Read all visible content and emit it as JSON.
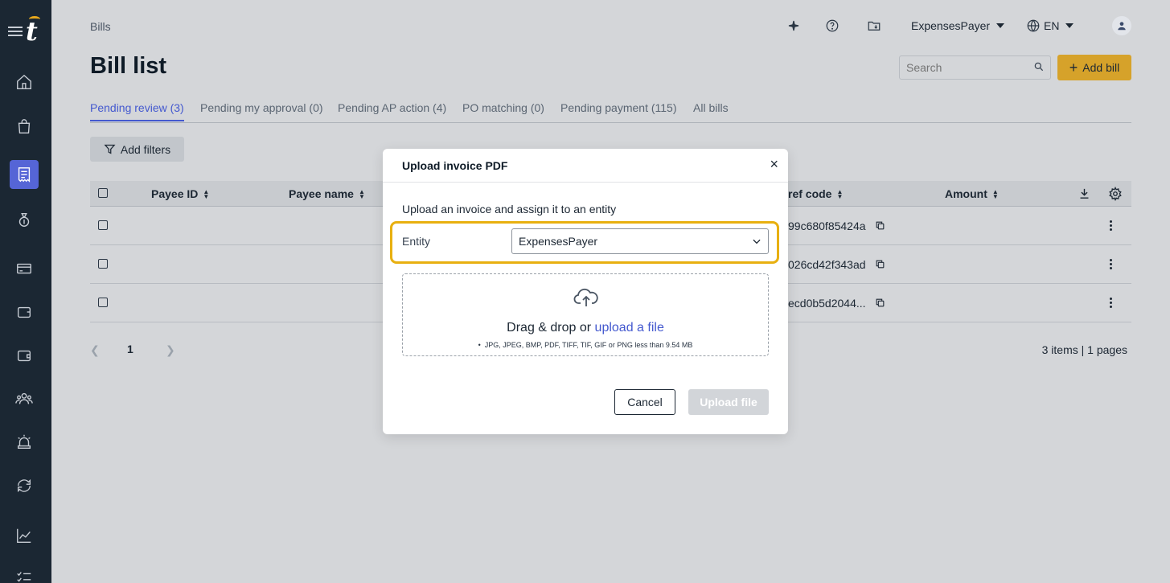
{
  "sidebar": {
    "logo_letter": "t",
    "items": [
      {
        "icon": "home-icon"
      },
      {
        "icon": "shopping-bag-icon"
      },
      {
        "icon": "receipt-icon",
        "active": true
      },
      {
        "icon": "money-bag-icon"
      },
      {
        "icon": "credit-card-icon"
      },
      {
        "icon": "wallet-icon"
      },
      {
        "icon": "wallet-alt-icon"
      },
      {
        "icon": "users-icon"
      },
      {
        "icon": "alarm-icon"
      },
      {
        "icon": "sync-icon"
      },
      {
        "icon": "chart-icon"
      },
      {
        "icon": "checklist-icon"
      }
    ]
  },
  "header": {
    "breadcrumb": "Bills",
    "title": "Bill list",
    "account_name": "ExpensesPayer",
    "language": "EN",
    "icons": [
      "sparkle-icon",
      "help-icon",
      "folder-icon",
      "globe-icon",
      "user-icon"
    ]
  },
  "search": {
    "placeholder": "Search"
  },
  "add_bill_label": "Add bill",
  "tabs": [
    {
      "label": "Pending review (3)",
      "active": true
    },
    {
      "label": "Pending my approval (0)"
    },
    {
      "label": "Pending AP action (4)"
    },
    {
      "label": "PO matching (0)"
    },
    {
      "label": "Pending payment (115)"
    },
    {
      "label": "All bills"
    }
  ],
  "filter_label": "Add filters",
  "table": {
    "columns": [
      "Payee ID",
      "Payee name",
      "ref code",
      "Amount"
    ],
    "rows": [
      {
        "ref_code": "99c680f85424a"
      },
      {
        "ref_code": "026cd42f343ad"
      },
      {
        "ref_code": "ecd0b5d2044..."
      }
    ]
  },
  "pager": {
    "current": "1",
    "summary": "3 items | 1 pages"
  },
  "modal": {
    "title": "Upload invoice PDF",
    "close": "×",
    "description": "Upload an invoice and assign it to an entity",
    "entity_label": "Entity",
    "entity_value": "ExpensesPayer",
    "drop_text": "Drag & drop or",
    "drop_link": "upload a file",
    "drop_hint": "JPG, JPEG, BMP, PDF, TIFF, TIF, GIF or PNG less than 9.54 MB",
    "cancel_label": "Cancel",
    "upload_label": "Upload file"
  },
  "colors": {
    "accent": "#4459cf",
    "brand_yellow": "#d6a22a",
    "highlight": "#e8b010",
    "sidebar_bg": "#1b2733"
  }
}
